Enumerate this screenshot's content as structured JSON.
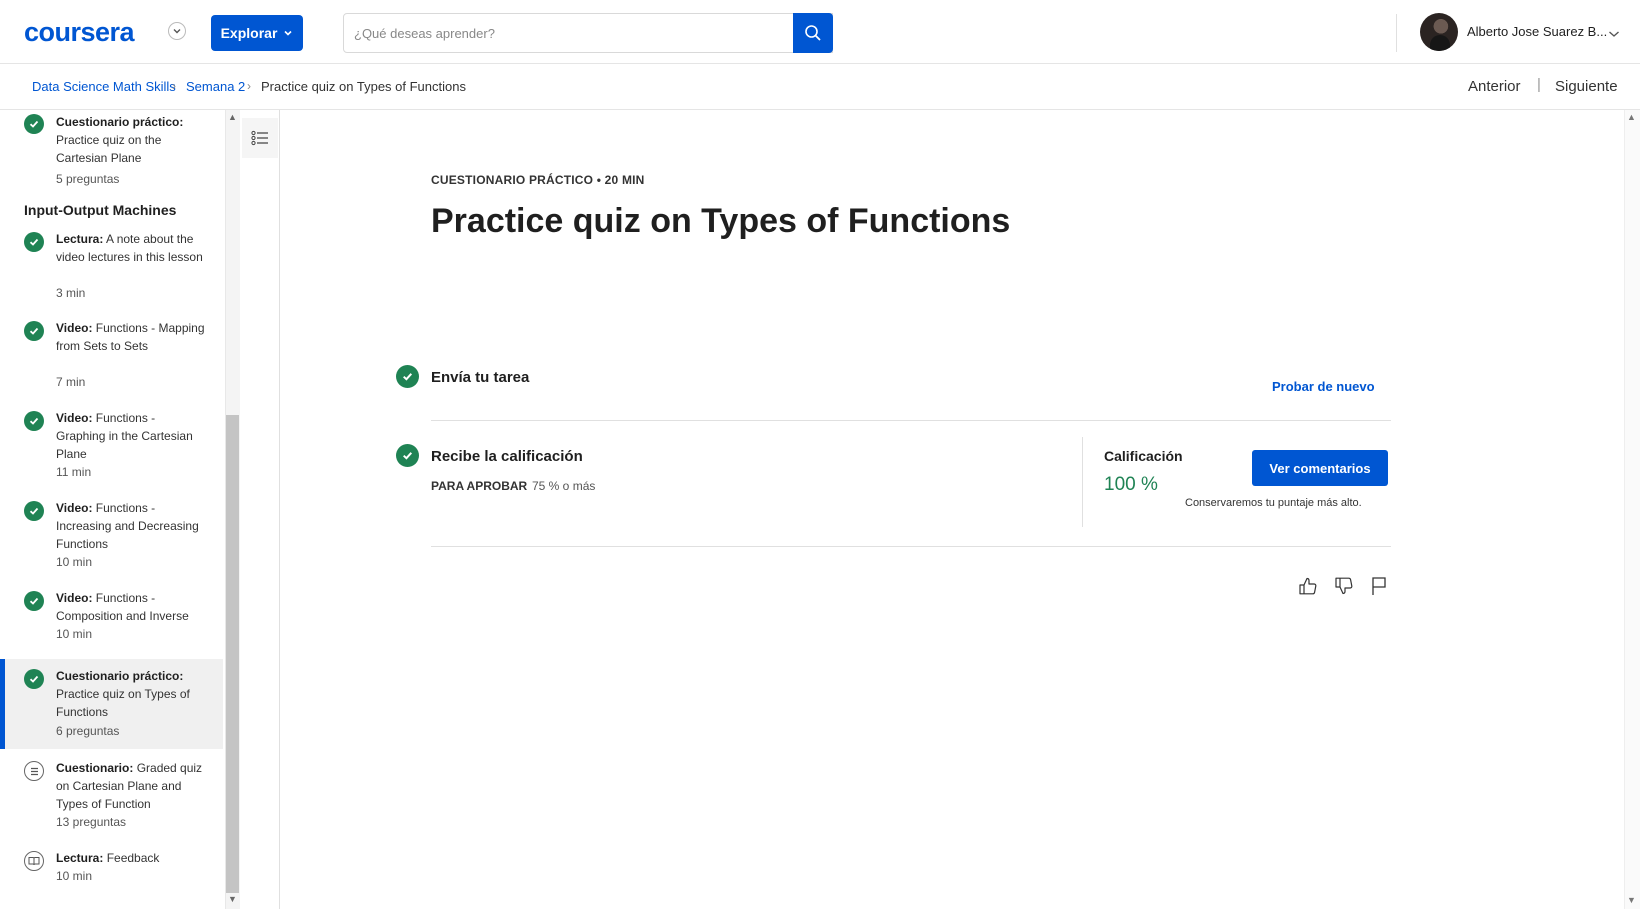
{
  "header": {
    "logo": "coursera",
    "explore_label": "Explorar",
    "search_placeholder": "¿Qué deseas aprender?",
    "user_name": "Alberto Jose Suarez B..."
  },
  "breadcrumb": {
    "course": "Data Science Math Skills",
    "week": "Semana 2",
    "current": "Practice quiz on Types of Functions",
    "prev_label": "Anterior",
    "separator": "|",
    "next_label": "Siguiente"
  },
  "sidebar": {
    "section_title": "Input-Output Machines",
    "items": [
      {
        "type": "Cuestionario práctico:",
        "title": "Practice quiz on the Cartesian Plane",
        "meta": "5 preguntas",
        "status": "done"
      },
      {
        "type": "Lectura:",
        "title": "A note about the video lectures in this lesson",
        "meta": "3 min",
        "status": "done"
      },
      {
        "type": "Video:",
        "title": "Functions - Mapping from Sets to Sets",
        "meta": "7 min",
        "status": "done"
      },
      {
        "type": "Video:",
        "title": "Functions - Graphing in the Cartesian Plane",
        "meta": "11 min",
        "status": "done"
      },
      {
        "type": "Video:",
        "title": "Functions - Increasing and Decreasing Functions",
        "meta": "10 min",
        "status": "done"
      },
      {
        "type": "Video:",
        "title": "Functions - Composition and Inverse",
        "meta": "10 min",
        "status": "done"
      },
      {
        "type": "Cuestionario práctico:",
        "title": "Practice quiz on Types of Functions",
        "meta": "6 preguntas",
        "status": "done"
      },
      {
        "type": "Cuestionario:",
        "title": "Graded quiz on Cartesian Plane and Types of Function",
        "meta": "13 preguntas",
        "status": "quiz"
      },
      {
        "type": "Lectura:",
        "title": "Feedback",
        "meta": "10 min",
        "status": "reading"
      }
    ]
  },
  "main": {
    "kicker": "CUESTIONARIO PRÁCTICO • 20 MIN",
    "title": "Practice quiz on Types of Functions",
    "step1_title": "Envía tu tarea",
    "retry_label": "Probar de nuevo",
    "step2_title": "Recibe la calificación",
    "pass_label": "PARA APROBAR",
    "pass_value": "75 % o más",
    "grade_label": "Calificación",
    "grade_value": "100 %",
    "feedback_button": "Ver comentarios",
    "keep_note": "Conservaremos tu puntaje más alto."
  },
  "colors": {
    "brand": "#0056d2",
    "success": "#1f8354"
  }
}
